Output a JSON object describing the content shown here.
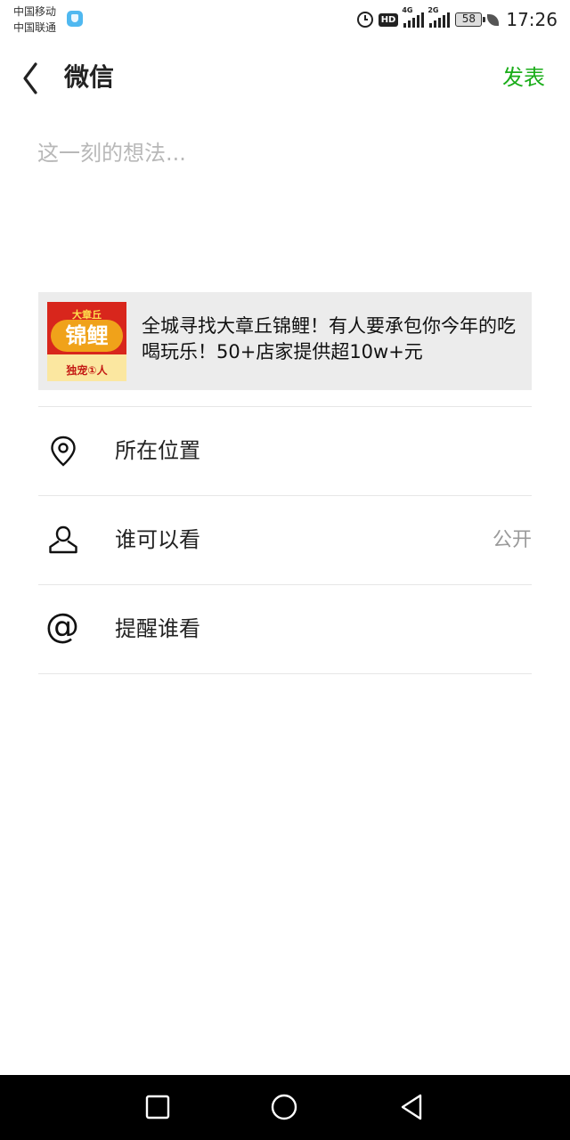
{
  "status_bar": {
    "carrier_1": "中国移动",
    "carrier_2": "中国联通",
    "network_1": "4G",
    "network_2": "2G",
    "hd": "HD",
    "battery": "58",
    "time": "17:26"
  },
  "header": {
    "title": "微信",
    "publish_label": "发表"
  },
  "compose": {
    "placeholder": "这一刻的想法..."
  },
  "link_card": {
    "thumb_top": "大章丘",
    "thumb_main": "锦鲤",
    "thumb_bottom": "独宠①人",
    "text": "全城寻找大章丘锦鲤！有人要承包你今年的吃喝玩乐！50+店家提供超10w+元"
  },
  "options": {
    "location": {
      "label": "所在位置",
      "icon": "location-pin-icon"
    },
    "visibility": {
      "label": "谁可以看",
      "value": "公开",
      "icon": "person-icon"
    },
    "mention": {
      "label": "提醒谁看",
      "icon": "at-icon",
      "glyph": "@"
    }
  },
  "colors": {
    "accent_green": "#1aad19",
    "placeholder_gray": "#b8b8b8",
    "card_bg": "#ececec"
  }
}
